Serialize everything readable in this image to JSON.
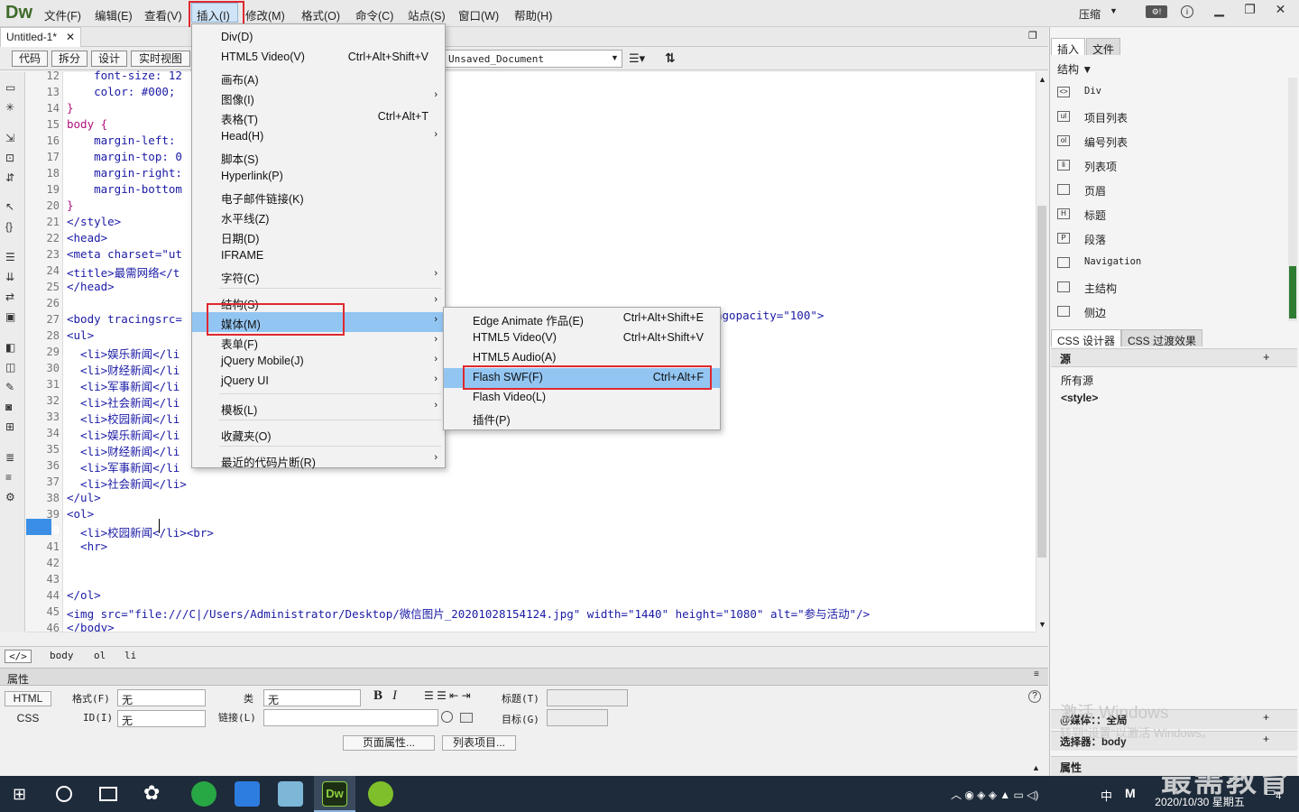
{
  "app": {
    "logo": "Dw",
    "compress_label": "压缩",
    "search_icon": "search"
  },
  "menubar": {
    "items": [
      "文件(F)",
      "编辑(E)",
      "查看(V)",
      "插入(I)",
      "修改(M)",
      "格式(O)",
      "命令(C)",
      "站点(S)",
      "窗口(W)",
      "帮助(H)"
    ]
  },
  "document": {
    "tab": "Untitled-1*",
    "title_field": "Unsaved_Document"
  },
  "toolbar": {
    "code": "代码",
    "split": "拆分",
    "design": "设计",
    "live": "实时视图"
  },
  "code": {
    "line_numbers": [
      "12",
      "13",
      "14",
      "15",
      "16",
      "17",
      "18",
      "19",
      "20",
      "21",
      "22",
      "23",
      "24",
      "25",
      "26",
      "27",
      "28",
      "29",
      "30",
      "31",
      "32",
      "33",
      "34",
      "35",
      "36",
      "37",
      "38",
      "39",
      "40",
      "41",
      "42",
      "43",
      "44",
      "45",
      "46"
    ],
    "lines": [
      "    font-size: 12",
      "    color: #000;",
      "}",
      "body {",
      "    margin-left:",
      "    margin-top: 0",
      "    margin-right:",
      "    margin-bottom",
      "}",
      "</style>",
      "<head>",
      "<meta charset=\"ut",
      "<title>最需网络</t",
      "</head>",
      "",
      "<body tracingsrc=",
      "<ul>",
      "  <li>娱乐新闻</li",
      "  <li>财经新闻</li",
      "  <li>军事新闻</li",
      "  <li>社会新闻</li",
      "  <li>校园新闻</li",
      "  <li>娱乐新闻</li",
      "  <li>财经新闻</li",
      "  <li>军事新闻</li",
      "  <li>社会新闻</li>",
      "</ul>",
      "<ol>",
      "  <li>校园新闻</li><br>",
      "  <hr>",
      "",
      "",
      "</ol>",
      "<img src=\"file:///C|/Users/Administrator/Desktop/微信图片_20201028154124.jpg\" width=\"1440\" height=\"1080\" alt=\"参与活动\"/>",
      "</body>"
    ],
    "body_tail": "ngopacity=\"100\">",
    "current_line": "40"
  },
  "insert_menu": {
    "items": [
      {
        "label": "Div(D)",
        "shortcut": "",
        "sub": false
      },
      {
        "label": "HTML5 Video(V)",
        "shortcut": "Ctrl+Alt+Shift+V",
        "sub": false
      },
      {
        "label": "画布(A)",
        "shortcut": "",
        "sub": false
      },
      {
        "label": "图像(I)",
        "shortcut": "",
        "sub": true
      },
      {
        "label": "表格(T)",
        "shortcut": "Ctrl+Alt+T",
        "sub": false
      },
      {
        "label": "Head(H)",
        "shortcut": "",
        "sub": true
      },
      {
        "label": "脚本(S)",
        "shortcut": "",
        "sub": false
      },
      {
        "label": "Hyperlink(P)",
        "shortcut": "",
        "sub": false
      },
      {
        "label": "电子邮件链接(K)",
        "shortcut": "",
        "sub": false
      },
      {
        "label": "水平线(Z)",
        "shortcut": "",
        "sub": false
      },
      {
        "label": "日期(D)",
        "shortcut": "",
        "sub": false
      },
      {
        "label": "IFRAME",
        "shortcut": "",
        "sub": false
      },
      {
        "label": "字符(C)",
        "shortcut": "",
        "sub": true
      },
      {
        "label": "结构(S)",
        "shortcut": "",
        "sub": true
      },
      {
        "label": "媒体(M)",
        "shortcut": "",
        "sub": true
      },
      {
        "label": "表单(F)",
        "shortcut": "",
        "sub": true
      },
      {
        "label": "jQuery Mobile(J)",
        "shortcut": "",
        "sub": true
      },
      {
        "label": "jQuery UI",
        "shortcut": "",
        "sub": true
      },
      {
        "label": "模板(L)",
        "shortcut": "",
        "sub": true
      },
      {
        "label": "收藏夹(O)",
        "shortcut": "",
        "sub": false
      },
      {
        "label": "最近的代码片断(R)",
        "shortcut": "",
        "sub": true
      }
    ]
  },
  "media_menu": {
    "items": [
      {
        "label": "Edge Animate 作品(E)",
        "shortcut": "Ctrl+Alt+Shift+E"
      },
      {
        "label": "HTML5 Video(V)",
        "shortcut": "Ctrl+Alt+Shift+V"
      },
      {
        "label": "HTML5 Audio(A)",
        "shortcut": ""
      },
      {
        "label": "Flash SWF(F)",
        "shortcut": "Ctrl+Alt+F"
      },
      {
        "label": "Flash Video(L)",
        "shortcut": ""
      },
      {
        "label": "插件(P)",
        "shortcut": ""
      }
    ]
  },
  "tag_selector": [
    "body",
    "ol",
    "li"
  ],
  "properties": {
    "title": "属性",
    "html_btn": "HTML",
    "css_btn": "CSS",
    "format_label": "格式(F)",
    "format_value": "无",
    "id_label": "ID(I)",
    "id_value": "无",
    "class_label": "类",
    "class_value": "无",
    "link_label": "链接(L)",
    "title_label": "标题(T)",
    "target_label": "目标(G)",
    "page_props_btn": "页面属性...",
    "list_item_btn": "列表项目..."
  },
  "right_panel": {
    "tabs": [
      "插入",
      "文件"
    ],
    "category": "结构",
    "items": [
      {
        "icon": "<>",
        "label": "Div"
      },
      {
        "icon": "ul",
        "label": "项目列表"
      },
      {
        "icon": "ol",
        "label": "编号列表"
      },
      {
        "icon": "li",
        "label": "列表项"
      },
      {
        "icon": "",
        "label": "页眉"
      },
      {
        "icon": "H",
        "label": "标题"
      },
      {
        "icon": "P",
        "label": "段落"
      },
      {
        "icon": "",
        "label": "Navigation"
      },
      {
        "icon": "",
        "label": "主结构"
      },
      {
        "icon": "",
        "label": "侧边"
      }
    ],
    "css_tabs": [
      "CSS 设计器",
      "CSS 过渡效果"
    ],
    "source_label": "源",
    "sources": [
      "所有源",
      "<style>"
    ],
    "media_label": "@媒体：：全局",
    "selector_label": "选择器：body",
    "props_label": "属性"
  },
  "watermark": {
    "activate_title": "激活 Windows",
    "activate_sub": "转到\"设置\"以激活 Windows。",
    "brand": "最需教育"
  },
  "taskbar": {
    "time": "2020/10/30 星期五",
    "ime": "中",
    "notifications": "4"
  }
}
